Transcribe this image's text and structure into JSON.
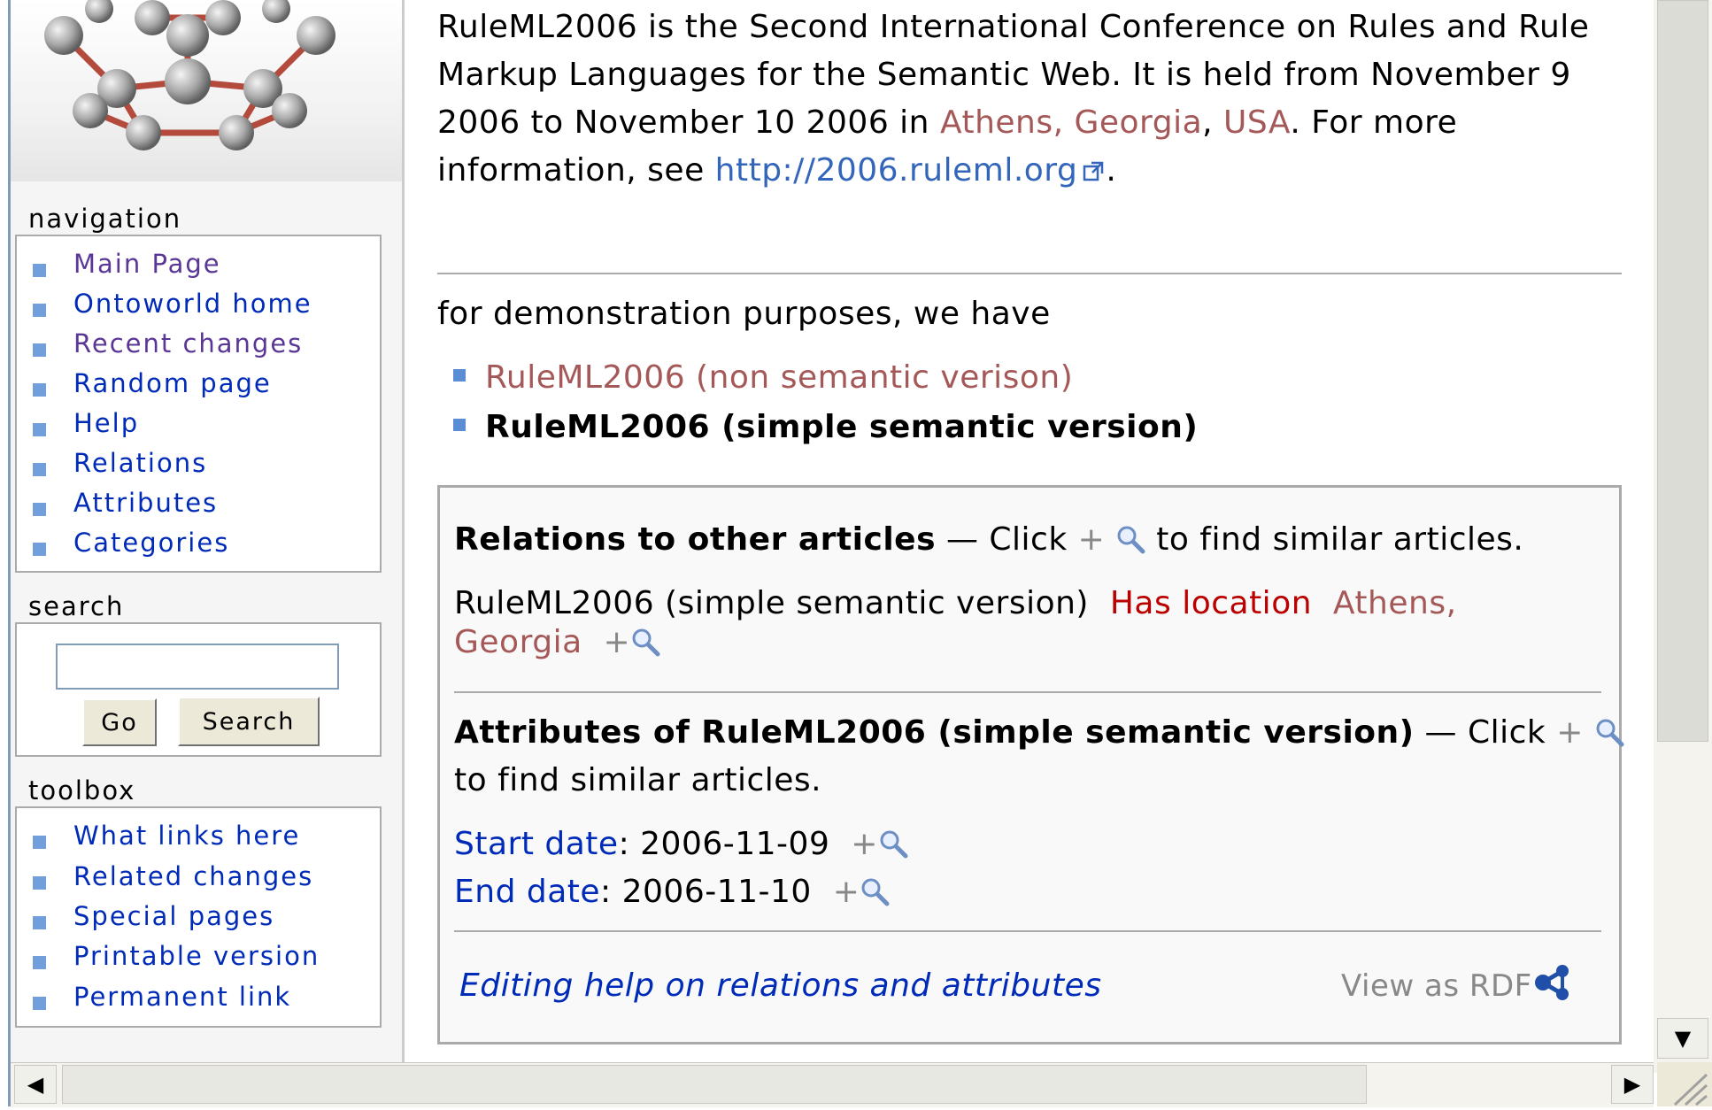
{
  "sidebar": {
    "navigation": {
      "title": "navigation",
      "items": [
        {
          "label": "Main Page"
        },
        {
          "label": "Ontoworld home"
        },
        {
          "label": "Recent changes"
        },
        {
          "label": "Random page"
        },
        {
          "label": "Help"
        },
        {
          "label": "Relations"
        },
        {
          "label": "Attributes"
        },
        {
          "label": "Categories"
        }
      ]
    },
    "search": {
      "title": "search",
      "input_value": "",
      "go_label": "Go",
      "search_label": "Search"
    },
    "toolbox": {
      "title": "toolbox",
      "items": [
        {
          "label": "What links here"
        },
        {
          "label": "Related changes"
        },
        {
          "label": "Special pages"
        },
        {
          "label": "Printable version"
        },
        {
          "label": "Permanent link"
        }
      ]
    }
  },
  "content": {
    "intro": {
      "line1": "RuleML2006 is the Second International Conference on Rules and Rule",
      "line2": "Markup Languages for the Semantic Web. It is held from November 9",
      "line3_prefix": "2006 to November 10 2006 in ",
      "city_link": "Athens, Georgia",
      "comma": ",",
      "country_link": "USA",
      "line3_suffix": ". For more",
      "line4_prefix": "information, see ",
      "url_link": "http://2006.ruleml.org",
      "line4_suffix": "."
    },
    "demo_text": "for demonstration purposes, we have",
    "versions": [
      {
        "label": "RuleML2006 (non semantic verison)"
      },
      {
        "label": "RuleML2006 (simple semantic version)"
      }
    ],
    "factbox": {
      "relations_heading": "Relations to other articles",
      "relations_hint_prefix": " — Click ",
      "relations_hint_suffix": " to find similar articles.",
      "relation_subject": "RuleML2006 (simple semantic version)",
      "relation_name": "Has location",
      "relation_value_1": "Athens,",
      "relation_value_2": "Georgia",
      "attributes_heading": "Attributes of RuleML2006 (simple semantic version)",
      "attributes_hint_prefix": " — Click ",
      "attributes_hint_suffix": "to find similar articles.",
      "attributes": [
        {
          "name": "Start date",
          "value": "2006-11-09"
        },
        {
          "name": "End date",
          "value": "2006-11-10"
        }
      ],
      "editing_help": "Editing help on relations and attributes",
      "view_rdf": "View as RDF",
      "plus": "+"
    }
  },
  "colors": {
    "link": "#002bb8",
    "visited": "#5a3696",
    "new_link": "#ba0000",
    "brown_link": "#a55858",
    "external": "#3366bb"
  }
}
